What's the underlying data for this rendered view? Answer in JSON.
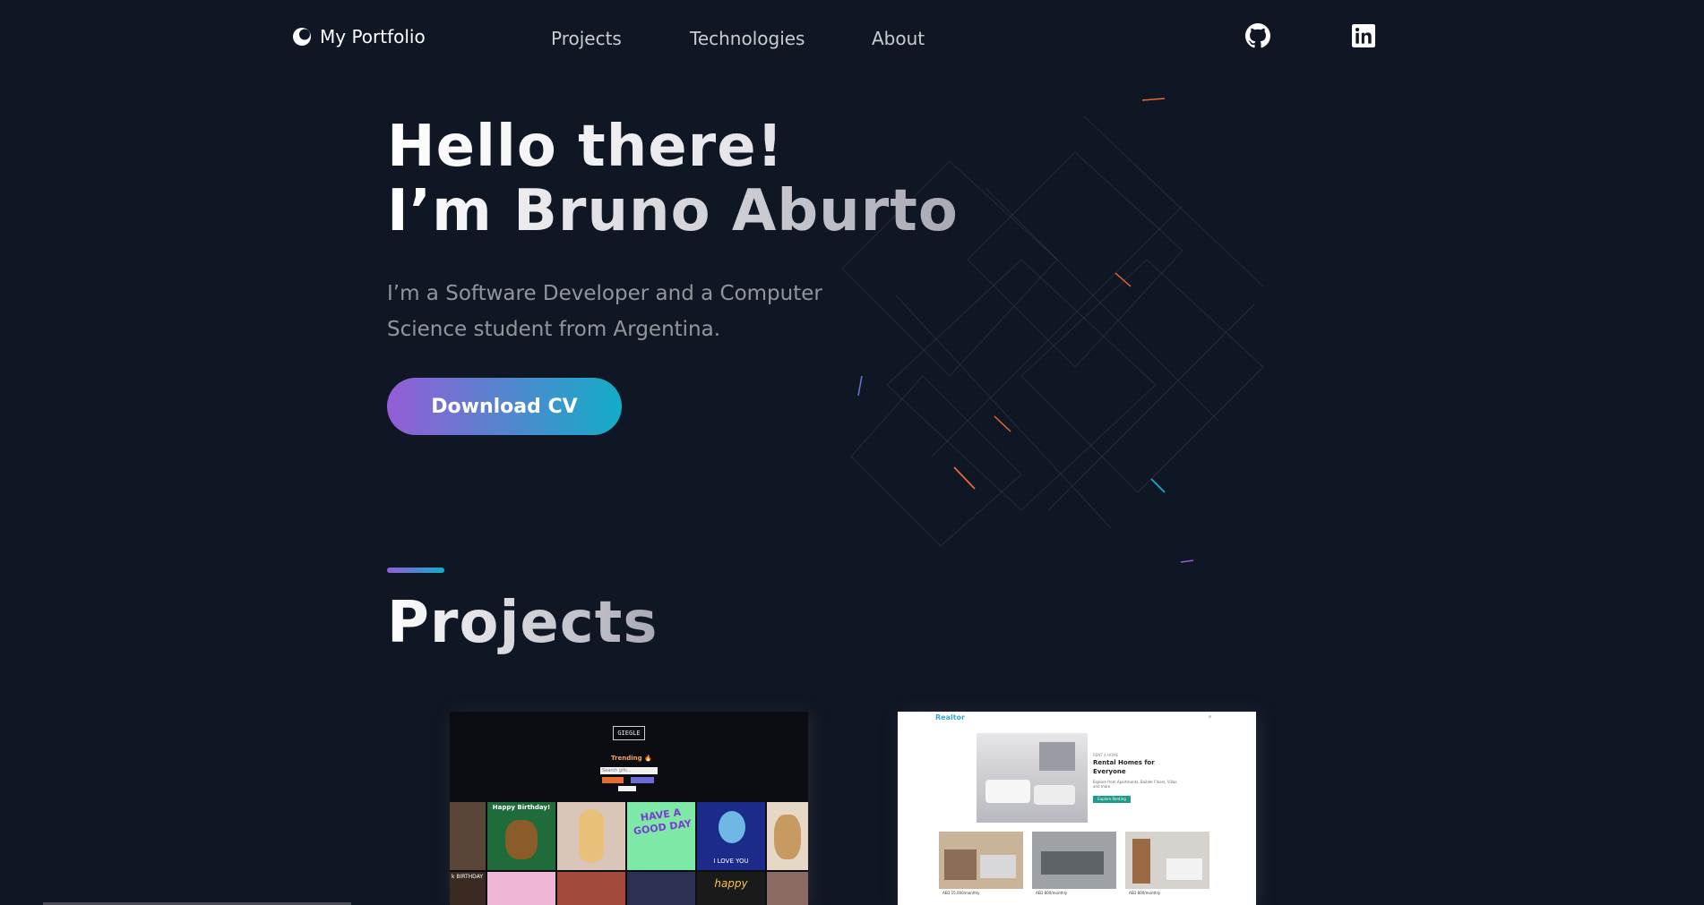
{
  "nav": {
    "logo_text": "My Portfolio",
    "links": [
      {
        "label": "Projects"
      },
      {
        "label": "Technologies"
      },
      {
        "label": "About"
      }
    ],
    "social": [
      {
        "icon": "github-icon"
      },
      {
        "icon": "linkedin-icon"
      }
    ]
  },
  "hero": {
    "title_line1": "Hello there!",
    "title_line2": "I’m Bruno Aburto",
    "subtitle": "I’m a Software Developer and a Computer Science student from Argentina.",
    "cv_button": "Download CV"
  },
  "projects": {
    "title": "Projects",
    "cards": [
      {
        "name": "Giggle",
        "thumb": {
          "logo": "GIEGLE",
          "trending": "Trending 🔥",
          "search_placeholder": "Search gifs...",
          "tiles": [
            "Happy Birthday!",
            "HAVE A GOOD DAY",
            "I LOVE YOU",
            "happy",
            "k BIRTHDAY"
          ]
        }
      },
      {
        "name": "Realtor",
        "thumb": {
          "brand": "Realtor",
          "tag": "RENT A HOME",
          "title": "Rental Homes for Everyone",
          "desc": "Explore from Apartments, Builder Floors, Villas and more",
          "button": "Explore Renting",
          "prices": [
            "AED 15,000/monthly",
            "AED 800/monthly",
            "AED 800/monthly"
          ]
        }
      }
    ]
  },
  "colors": {
    "background": "#0f1624",
    "gradient_start": "#945dd6",
    "gradient_mid": "#6978d1",
    "gradient_end": "#13adc7"
  }
}
